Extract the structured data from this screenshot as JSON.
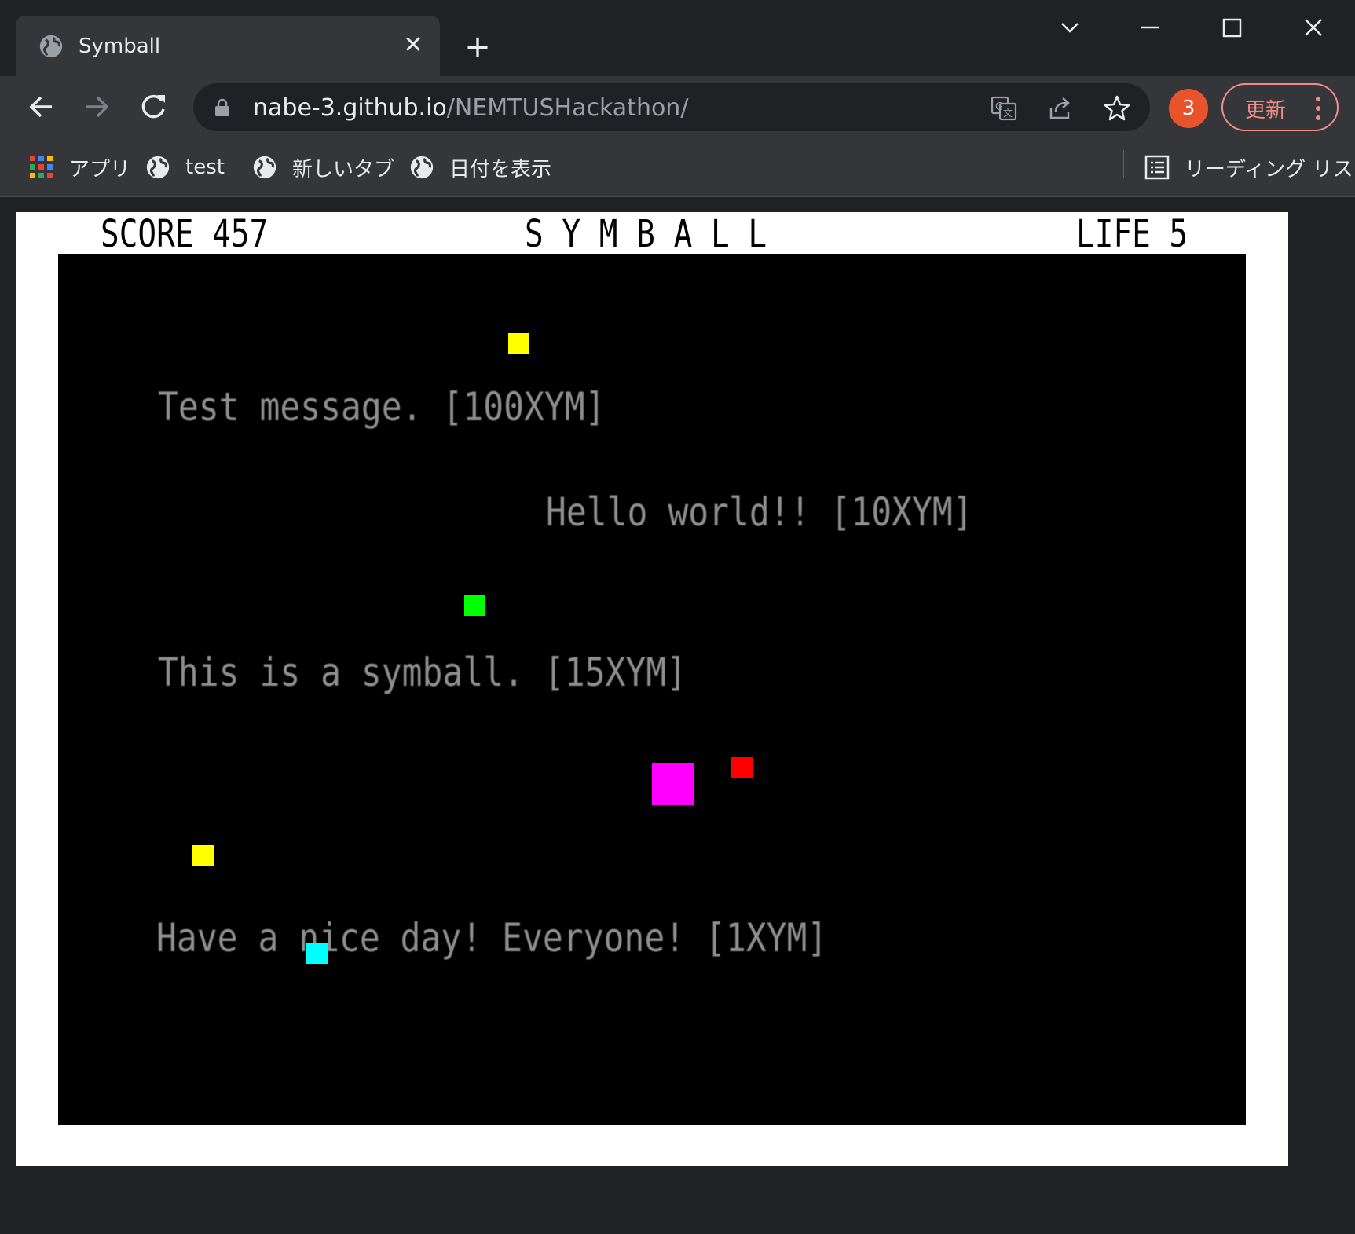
{
  "browser": {
    "tab": {
      "title": "Symball"
    },
    "omnibox": {
      "host": "nabe-3.github.io",
      "path": "/NEMTUSHackathon/"
    },
    "extensions_badge": "3",
    "update_label": "更新",
    "bookmarks": [
      {
        "label": "アプリ",
        "icon": "apps-grid-icon"
      },
      {
        "label": "test",
        "icon": "globe-icon"
      },
      {
        "label": "新しいタブ",
        "icon": "globe-icon"
      },
      {
        "label": "日付を表示",
        "icon": "globe-icon"
      }
    ],
    "reading_list_label": "リーディング リスト",
    "colors": {
      "frame": "#202124",
      "toolbar": "#35363a",
      "text": "#e8eaed",
      "update_accent": "#f28b82",
      "badge": "#e8532b"
    }
  },
  "game": {
    "score_label": "SCORE 457",
    "title": "S Y M B A L L",
    "life_label": "LIFE 5",
    "messages": [
      {
        "text": "Test message. [100XYM]"
      },
      {
        "text": "Hello world!! [10XYM]"
      },
      {
        "text": "This is a symball. [15XYM]"
      },
      {
        "text": "Have a nice day! Everyone! [1XYM]"
      }
    ],
    "block_colors": {
      "yellow": "#ffff00",
      "green": "#00ff00",
      "magenta": "#ff00ff",
      "red": "#ff0000",
      "cyan": "#00ffff"
    },
    "colors": {
      "playfield": "#000000",
      "message_text": "#8f8f8f",
      "frame": "#ffffff"
    }
  }
}
